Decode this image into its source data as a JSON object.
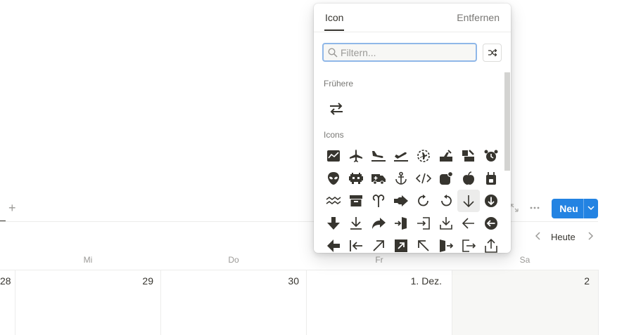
{
  "popover": {
    "tab_icon": "Icon",
    "remove": "Entfernen",
    "search_placeholder": "Filtern...",
    "recent_label": "Frühere",
    "icons_label": "Icons",
    "recent_icons": [
      "arrows-swap-icon"
    ],
    "icon_rows": [
      [
        "chart-area-icon",
        "airplane-icon",
        "airplane-landing-icon",
        "airplane-takeoff-icon",
        "airplane-circle-icon",
        "airport-icon",
        "airport-alt-icon",
        "alarm-clock-icon"
      ],
      [
        "alien-icon",
        "space-invader-icon",
        "ambulance-icon",
        "anchor-icon",
        "code-icon",
        "apple-notification-icon",
        "apple-icon",
        "appliance-icon"
      ],
      [
        "aquarius-icon",
        "archive-box-icon",
        "aries-icon",
        "arrow-bold-right-icon",
        "arrow-rotate-clockwise-icon",
        "arrow-rotate-counterclockwise-icon",
        "arrow-down-icon",
        "arrow-down-circle-icon"
      ],
      [
        "arrow-down-bold-icon",
        "arrow-down-to-line-icon",
        "arrow-forward-icon",
        "arrow-into-door-icon",
        "arrow-into-box-icon",
        "arrow-download-icon",
        "arrow-left-icon",
        "arrow-left-circle-icon"
      ],
      [
        "arrow-left-bold-icon",
        "arrow-left-to-line-icon",
        "arrow-up-right-icon",
        "arrow-up-right-box-icon",
        "arrow-up-left-icon",
        "arrow-out-door-icon",
        "arrow-out-box-icon",
        "arrow-share-icon"
      ]
    ]
  },
  "calendar": {
    "new_button": "Neu",
    "today": "Heute",
    "day_headers": [
      "Mi",
      "Do",
      "Fr",
      "Sa"
    ],
    "dates": [
      "28",
      "29",
      "30",
      "1. Dez.",
      "2"
    ]
  }
}
